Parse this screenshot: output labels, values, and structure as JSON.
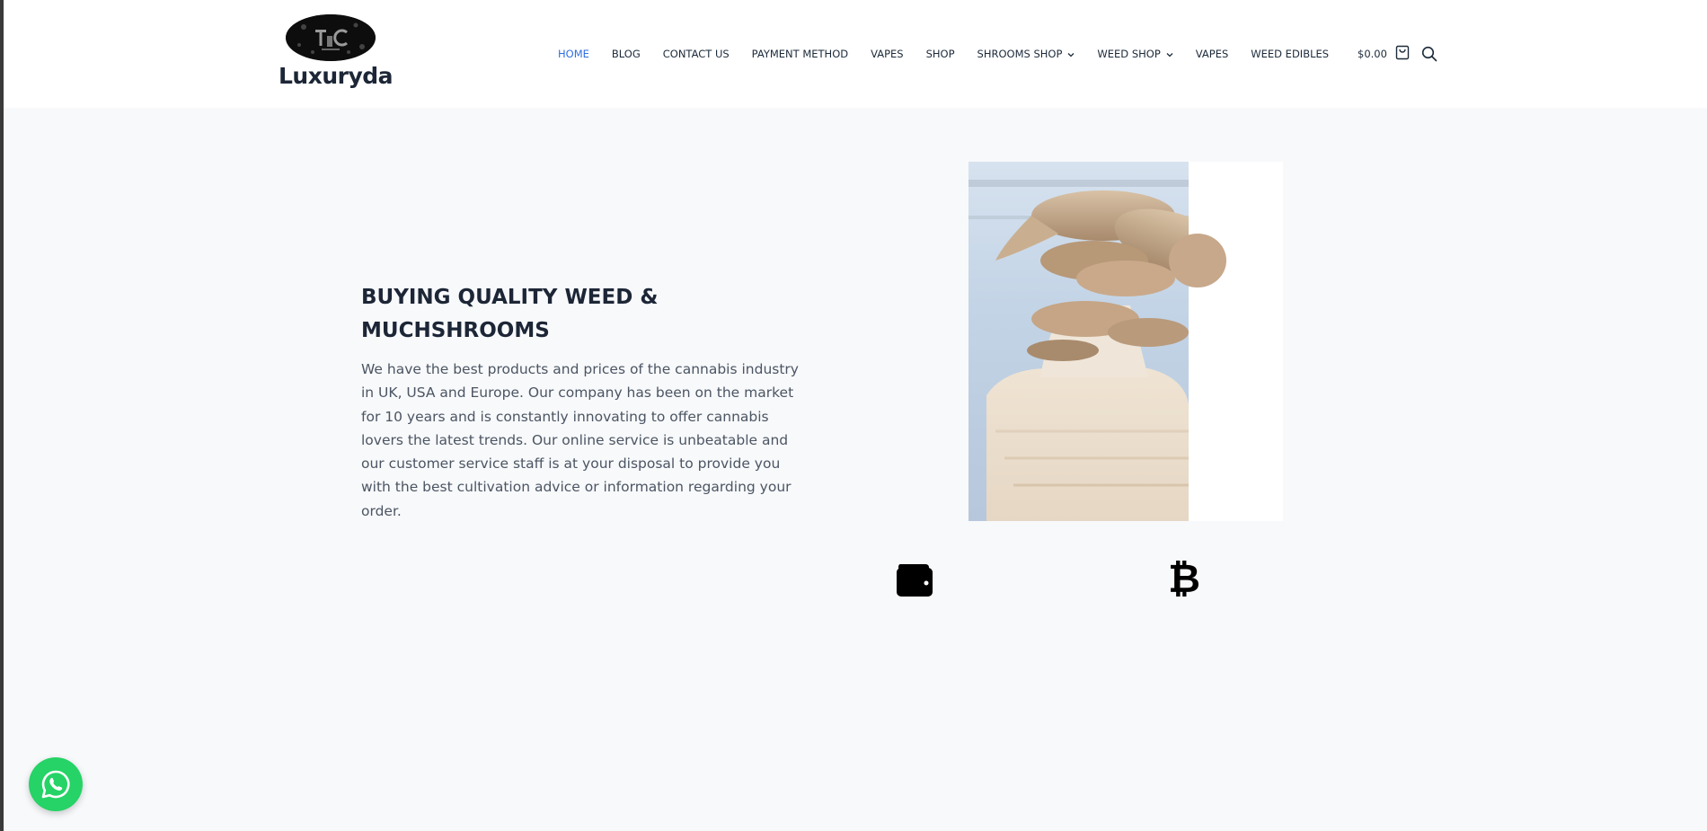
{
  "brand": {
    "name": "Luxuryda",
    "logo_icon": "tc-oval-logo"
  },
  "nav": {
    "items": [
      {
        "label": "HOME",
        "active": true
      },
      {
        "label": "BLOG"
      },
      {
        "label": "CONTACT US"
      },
      {
        "label": "PAYMENT METHOD"
      },
      {
        "label": "VAPES"
      },
      {
        "label": "SHOP"
      },
      {
        "label": "SHROOMS SHOP",
        "dropdown": true
      },
      {
        "label": "WEED SHOP",
        "dropdown": true
      },
      {
        "label": "VAPES"
      },
      {
        "label": "WEED EDIBLES"
      }
    ]
  },
  "cart": {
    "amount": "$0.00",
    "icon": "shopping-bag-icon"
  },
  "search": {
    "icon": "search-icon"
  },
  "hero": {
    "title": "BUYING QUALITY WEED & MUCHSHROOMS",
    "body": "We have the best products and prices of the cannabis industry in UK, USA and Europe. Our company has been on the market for 10 years and is constantly innovating to offer cannabis lovers the latest trends. Our online service is unbeatable and our customer service staff is at your disposal to provide you with the best cultivation advice or information regarding your order.",
    "image": "oyster-mushroom-photo"
  },
  "payment_icons": {
    "wallet": "wallet-icon",
    "bitcoin": "bitcoin-icon",
    "bitcoin_glyph": "₿"
  },
  "floating": {
    "whatsapp": "whatsapp-icon"
  },
  "colors": {
    "accent": "#2f6fe0",
    "text_dark": "#1c2636",
    "text_body": "#4b5563",
    "background": "#f8f9fb",
    "whatsapp": "#25d366"
  }
}
